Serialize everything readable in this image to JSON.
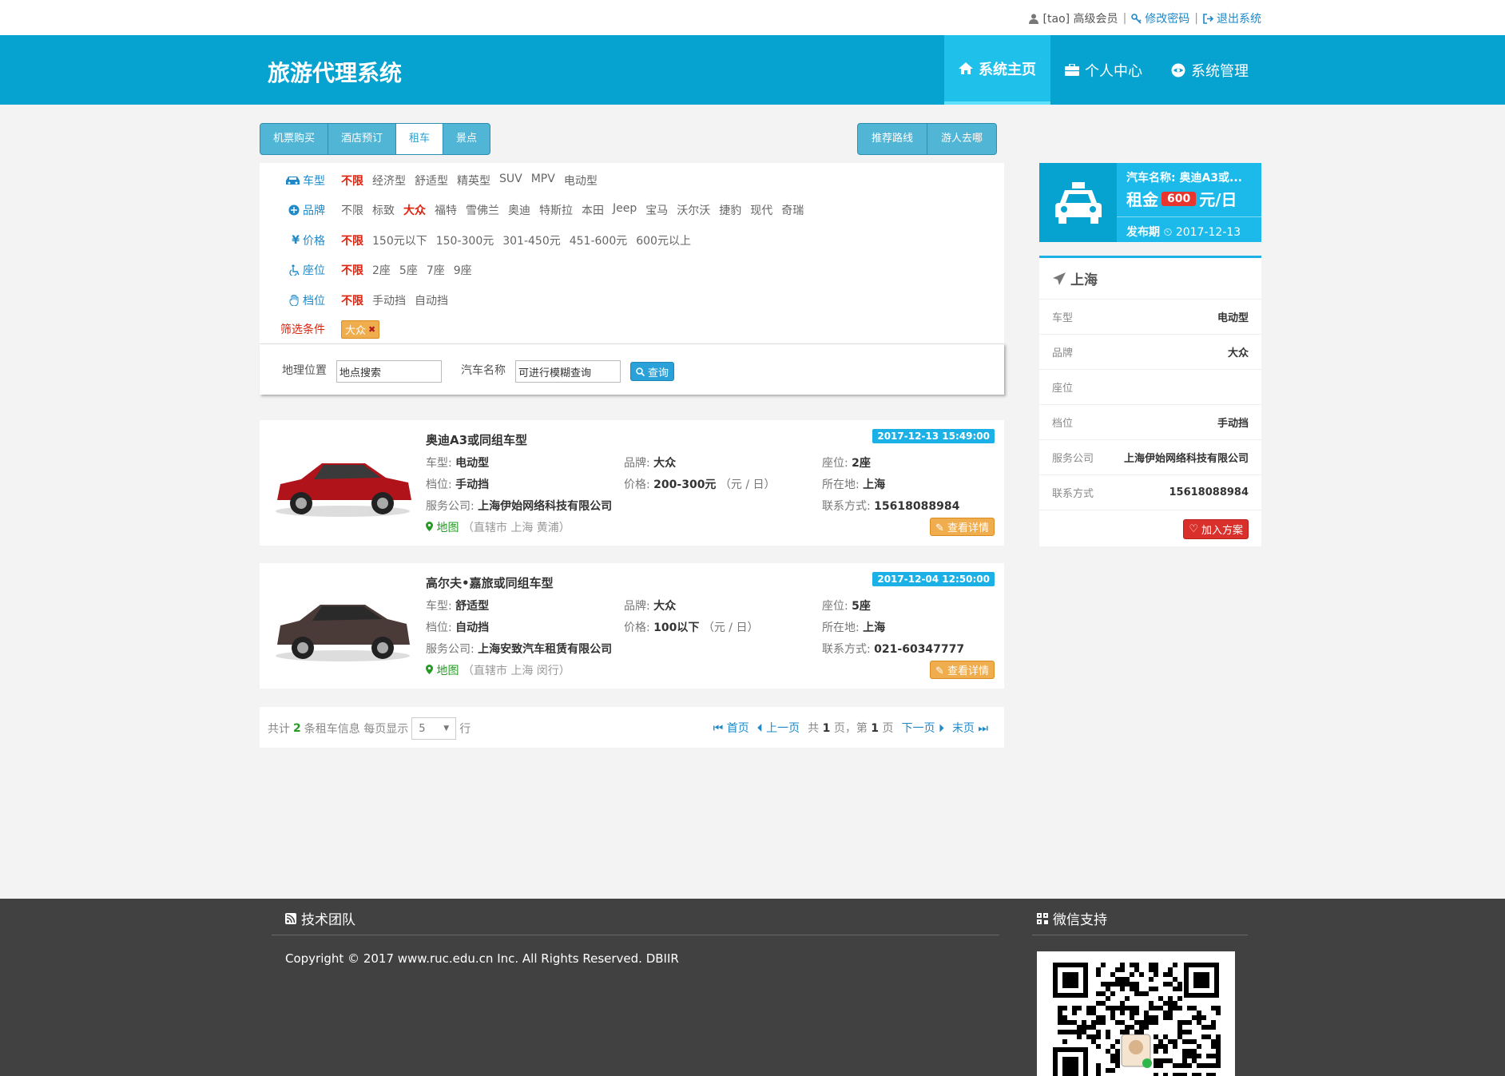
{
  "topbar": {
    "user": "[tao] 高级会员",
    "sep": "|",
    "change_password": "修改密码",
    "logout": "退出系统"
  },
  "nav": {
    "brand": "旅游代理系统",
    "items": [
      {
        "label": "系统主页",
        "icon": "home-icon"
      },
      {
        "label": "个人中心",
        "icon": "briefcase-icon"
      },
      {
        "label": "系统管理",
        "icon": "eye-icon"
      }
    ]
  },
  "tabs": {
    "left": [
      "机票购买",
      "酒店预订",
      "租车",
      "景点"
    ],
    "right": [
      "推荐路线",
      "游人去哪"
    ]
  },
  "filters": {
    "rows": [
      {
        "label": "车型",
        "icon": "car-icon",
        "options": [
          "不限",
          "经济型",
          "舒适型",
          "精英型",
          "SUV",
          "MPV",
          "电动型"
        ]
      },
      {
        "label": "品牌",
        "icon": "brand-icon",
        "options": [
          "不限",
          "标致",
          "大众",
          "福特",
          "雪佛兰",
          "奥迪",
          "特斯拉",
          "本田",
          "Jeep",
          "宝马",
          "沃尔沃",
          "捷豹",
          "现代",
          "奇瑞"
        ]
      },
      {
        "label": "价格",
        "icon": "yen-icon",
        "options": [
          "不限",
          "150元以下",
          "150-300元",
          "301-450元",
          "451-600元",
          "600元以上"
        ]
      },
      {
        "label": "座位",
        "icon": "wheelchair-icon",
        "options": [
          "不限",
          "2座",
          "5座",
          "7座",
          "9座"
        ]
      },
      {
        "label": "档位",
        "icon": "hand-icon",
        "options": [
          "不限",
          "手动挡",
          "自动挡"
        ]
      }
    ],
    "condition_label": "筛选条件",
    "condition_chip": "大众",
    "close_glyph": "✖"
  },
  "search": {
    "location_label": "地理位置",
    "location_value": "地点搜索",
    "name_label": "汽车名称",
    "name_value": "可进行模糊查询",
    "button": "查询"
  },
  "cars": [
    {
      "title": "奥迪A3或同组车型",
      "date": "2017-12-13 15:49:00",
      "type_k": "车型:",
      "type_v": "电动型",
      "brand_k": "品牌:",
      "brand_v": "大众",
      "seat_k": "座位:",
      "seat_v": "2座",
      "gear_k": "档位:",
      "gear_v": "手动挡",
      "price_k": "价格:",
      "price_v": "200-300元",
      "price_unit": "（元 / 日）",
      "loc_k": "所在地:",
      "loc_v": "上海",
      "company_k": "服务公司:",
      "company_v": "上海伊始网络科技有限公司",
      "phone_k": "联系方式:",
      "phone_v": "15618088984",
      "map": "地图",
      "map_addr": "（直辖市 上海 黄浦）",
      "detail": "查看详情",
      "color": "#b0141a"
    },
    {
      "title": "高尔夫•嘉旅或同组车型",
      "date": "2017-12-04 12:50:00",
      "type_k": "车型:",
      "type_v": "舒适型",
      "brand_k": "品牌:",
      "brand_v": "大众",
      "seat_k": "座位:",
      "seat_v": "5座",
      "gear_k": "档位:",
      "gear_v": "自动挡",
      "price_k": "价格:",
      "price_v": "100以下",
      "price_unit": "（元 / 日）",
      "loc_k": "所在地:",
      "loc_v": "上海",
      "company_k": "服务公司:",
      "company_v": "上海安致汽车租赁有限公司",
      "phone_k": "联系方式:",
      "phone_v": "021-60347777",
      "map": "地图",
      "map_addr": "（直辖市 上海 闵行）",
      "detail": "查看详情",
      "color": "#4a3b38"
    }
  ],
  "pager": {
    "total_pre": "共计",
    "total": "2",
    "total_post": "条租车信息 每页显示",
    "per_page": "5",
    "rows_suffix": "行",
    "first": "首页",
    "prev": "上一页",
    "pages_pre": "共",
    "pages": "1",
    "pages_mid": "页，第",
    "page": "1",
    "pages_post": "页",
    "next": "下一页",
    "last": "末页"
  },
  "summary": {
    "name": "汽车名称: 奥迪A3或...",
    "rent_label": "租金",
    "rent": "600",
    "rent_unit": "元/日",
    "publish_label": "发布期",
    "publish_date": "2017-12-13"
  },
  "panel": {
    "city": "上海",
    "rows": [
      {
        "k": "车型",
        "v": "电动型"
      },
      {
        "k": "品牌",
        "v": "大众"
      },
      {
        "k": "座位",
        "v": ""
      },
      {
        "k": "档位",
        "v": "手动挡"
      },
      {
        "k": "服务公司",
        "v": "上海伊始网络科技有限公司"
      },
      {
        "k": "联系方式",
        "v": "15618088984"
      }
    ],
    "add_button": "加入方案"
  },
  "footer": {
    "team_title": "技术团队",
    "wechat_title": "微信支持",
    "copyright": "Copyright © 2017 www.ruc.edu.cn Inc. All Rights Reserved. DBIIR"
  },
  "colors": {
    "brand": "#06a3d0",
    "active_nav": "#1fc0ea",
    "selected_filter": "#e0220d",
    "footer": "#414141"
  }
}
